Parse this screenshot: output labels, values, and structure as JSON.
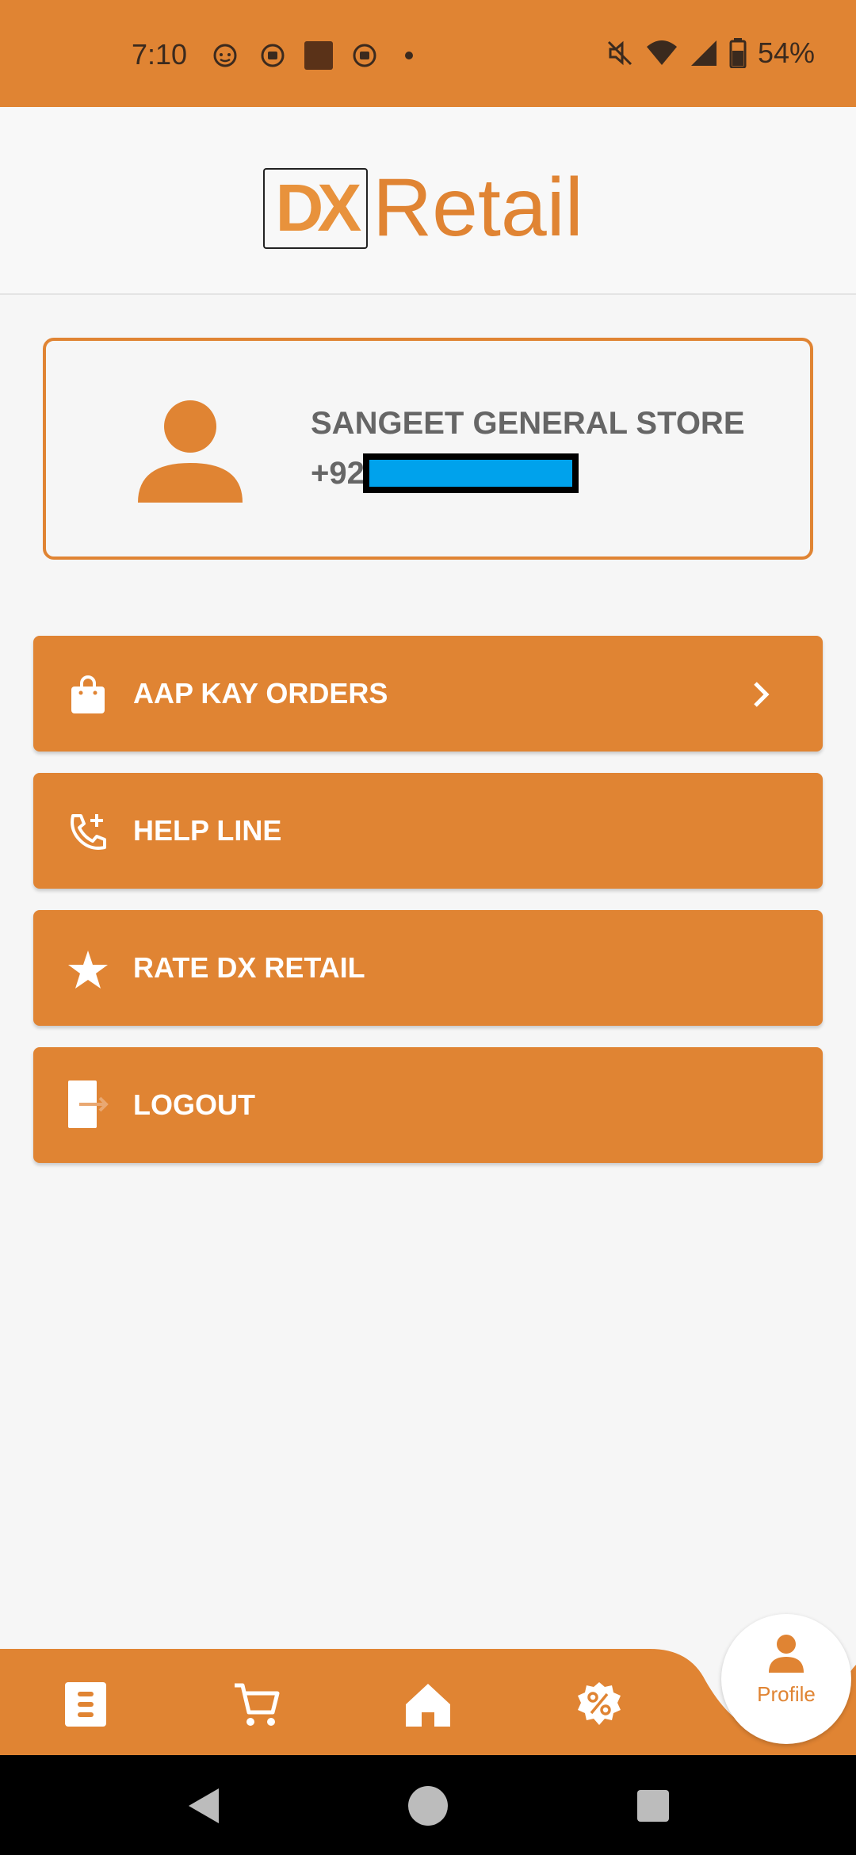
{
  "status_bar": {
    "time": "7:10",
    "battery": "54%",
    "icons": [
      "face-notification-icon",
      "media-notification-icon",
      "square-notification-icon",
      "media-notification-icon-2",
      "dot-icon",
      "mute-icon",
      "wifi-icon",
      "cellular-signal-icon",
      "battery-icon"
    ]
  },
  "header": {
    "logo_dx": "DX",
    "logo_retail": "Retail"
  },
  "profile": {
    "store_name": "SANGEET GENERAL STORE",
    "phone_prefix": "+92",
    "avatar_icon": "person-icon"
  },
  "menu": [
    {
      "label": "AAP KAY ORDERS",
      "icon": "shopping-bag-icon",
      "chevron": true
    },
    {
      "label": "HELP LINE",
      "icon": "phone-add-icon",
      "chevron": false
    },
    {
      "label": "RATE DX RETAIL",
      "icon": "star-icon",
      "chevron": false
    },
    {
      "label": "LOGOUT",
      "icon": "logout-icon",
      "chevron": false
    }
  ],
  "bottom_nav": {
    "items": [
      "list-icon",
      "cart-icon",
      "home-icon",
      "discount-icon"
    ],
    "active_label": "Profile"
  },
  "colors": {
    "accent": "#e08433",
    "background": "#f6f6f6",
    "text_gray": "#666666",
    "redaction": "#00a2ec"
  }
}
